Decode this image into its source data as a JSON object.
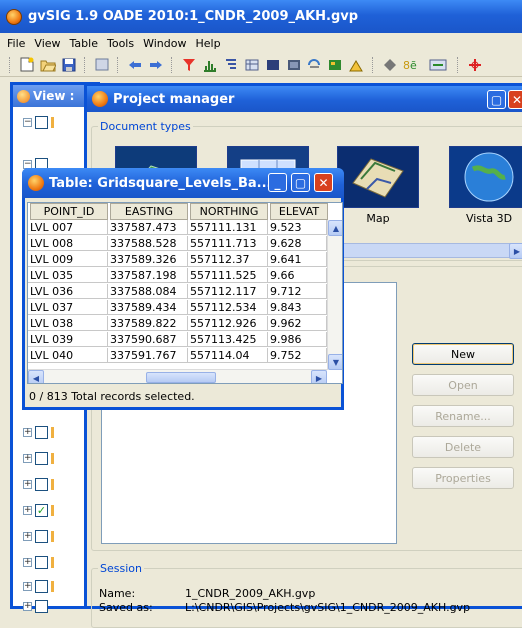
{
  "app": {
    "title": "gvSIG 1.9 OADE 2010:1_CNDR_2009_AKH.gvp"
  },
  "menu": [
    "File",
    "View",
    "Table",
    "Tools",
    "Window",
    "Help"
  ],
  "toolbar_icons": [
    "new-project-icon",
    "open-project-icon",
    "save-project-icon",
    "table-icon",
    "back-icon",
    "forward-icon",
    "filter-icon",
    "statistics-icon",
    "sort-icon",
    "join-icon",
    "link-icon",
    "export-icon",
    "field-calc-icon",
    "add-row-icon",
    "select-all-icon",
    "clear-selection-icon",
    "invert-selection-icon",
    "refresh-icon"
  ],
  "view_window": {
    "title": "View :"
  },
  "project_manager": {
    "title": "Project manager",
    "document_types_label": "Document types",
    "doc_types": [
      {
        "label": "",
        "icon": "view-doc-icon"
      },
      {
        "label": "",
        "icon": "table-doc-icon"
      },
      {
        "label": "Map",
        "icon": "map-doc-icon"
      },
      {
        "label": "Vista 3D",
        "icon": "globe-doc-icon"
      }
    ],
    "buttons": {
      "new": "New",
      "open": "Open",
      "rename": "Rename...",
      "delete": "Delete",
      "properties": "Properties"
    },
    "session": {
      "label": "Session",
      "name_key": "Name:",
      "name_value": "1_CNDR_2009_AKH.gvp",
      "saved_key": "Saved as:",
      "saved_value": "L:\\CNDR\\GIS\\Projects\\gvSIG\\1_CNDR_2009_AKH.gvp"
    }
  },
  "table_window": {
    "title": "Table: Gridsquare_Levels_Ba...",
    "columns": [
      "POINT_ID",
      "EASTING",
      "NORTHING",
      "ELEVAT"
    ],
    "rows": [
      [
        "LVL 007",
        "337587.473",
        "557111.131",
        "9.523"
      ],
      [
        "LVL 008",
        "337588.528",
        "557111.713",
        "9.628"
      ],
      [
        "LVL 009",
        "337589.326",
        "557112.37",
        "9.641"
      ],
      [
        "LVL 035",
        "337587.198",
        "557111.525",
        "9.66"
      ],
      [
        "LVL 036",
        "337588.084",
        "557112.117",
        "9.712"
      ],
      [
        "LVL 037",
        "337589.434",
        "557112.534",
        "9.843"
      ],
      [
        "LVL 038",
        "337589.822",
        "557112.926",
        "9.962"
      ],
      [
        "LVL 039",
        "337590.687",
        "557113.425",
        "9.986"
      ],
      [
        "LVL 040",
        "337591.767",
        "557114.04",
        "9.752"
      ]
    ],
    "status": "0 / 813 Total records selected."
  },
  "colors": {
    "title_blue": "#1f61d8",
    "window_border": "#0a52d6",
    "xp_face": "#ece9d8",
    "close_red": "#d8411e"
  }
}
